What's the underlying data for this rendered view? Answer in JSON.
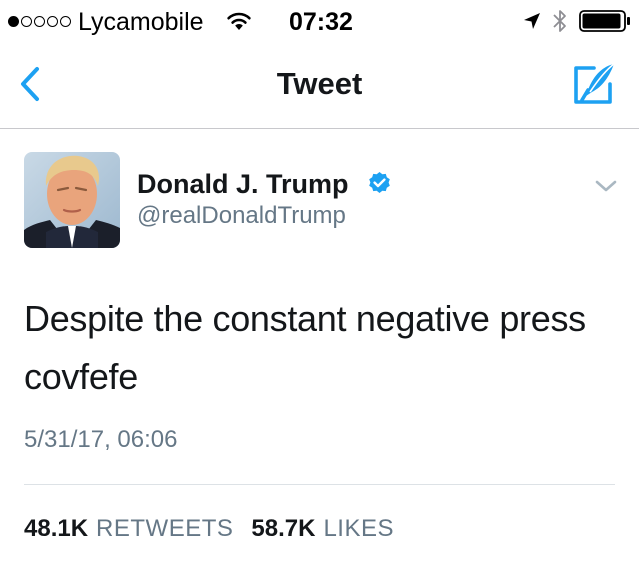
{
  "status_bar": {
    "signal_filled": 1,
    "signal_total": 5,
    "carrier": "Lycamobile",
    "time": "07:32",
    "icons": [
      "wifi-icon",
      "location-arrow-icon",
      "bluetooth-icon",
      "battery-icon"
    ],
    "battery_level": 0.95
  },
  "nav": {
    "back_icon": "chevron-left-icon",
    "title": "Tweet",
    "compose_icon": "compose-tweet-icon"
  },
  "tweet": {
    "author": {
      "name": "Donald J. Trump",
      "handle": "@realDonaldTrump",
      "verified": true,
      "verified_icon": "verified-badge-icon"
    },
    "menu_icon": "chevron-down-icon",
    "text": "Despite the constant negative press covfefe",
    "timestamp": "5/31/17, 06:06",
    "stats": {
      "retweets_count": "48.1K",
      "retweets_label": "RETWEETS",
      "likes_count": "58.7K",
      "likes_label": "LIKES"
    }
  },
  "colors": {
    "accent": "#1DA1F2",
    "text_primary": "#14171A",
    "text_secondary": "#657786",
    "divider": "#DDE2E6"
  }
}
